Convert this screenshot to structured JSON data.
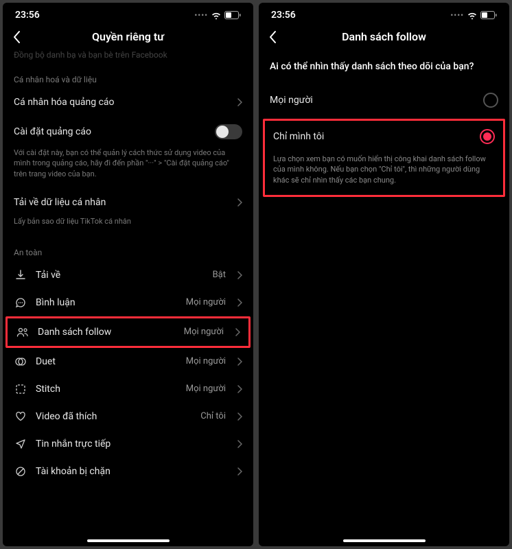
{
  "status": {
    "time": "23:56"
  },
  "left": {
    "title": "Quyền riêng tư",
    "faded": "Đồng bộ danh bạ và bạn bè trên Facebook",
    "section_personal": "Cá nhân hoá và dữ liệu",
    "row_ad_personal": "Cá nhân hóa quảng cáo",
    "row_ad_settings": "Cài đặt quảng cáo",
    "ad_settings_desc": "Với cài đặt này, bạn có thể quản lý cách thức sử dụng video của mình trong quảng cáo, hãy đi đến phần \"···\" > \"Cài đặt quảng cáo\" trên trang video của bạn.",
    "row_download_data": "Tải về dữ liệu cá nhân",
    "download_data_desc": "Lấy bản sao dữ liệu TikTok cá nhân",
    "section_safety": "An toàn",
    "row_download": {
      "label": "Tải về",
      "value": "Bật"
    },
    "row_comment": {
      "label": "Bình luận",
      "value": "Mọi người"
    },
    "row_follow": {
      "label": "Danh sách follow",
      "value": "Mọi người"
    },
    "row_duet": {
      "label": "Duet",
      "value": "Mọi người"
    },
    "row_stitch": {
      "label": "Stitch",
      "value": "Mọi người"
    },
    "row_liked": {
      "label": "Video đã thích",
      "value": "Chỉ tôi"
    },
    "row_dm": {
      "label": "Tin nhắn trực tiếp"
    },
    "row_blocked": {
      "label": "Tài khoản bị chặn"
    }
  },
  "right": {
    "title": "Danh sách follow",
    "question": "Ai có thể nhìn thấy danh sách theo dõi của bạn?",
    "opt_everyone": "Mọi người",
    "opt_only_me": "Chỉ mình tôi",
    "opt_only_me_desc": "Lựa chọn xem bạn có muốn hiển thị công khai danh sách follow của mình không. Nếu bạn chọn \"Chỉ tôi\", thì những người dùng khác sẽ chỉ nhìn thấy các bạn chung."
  }
}
